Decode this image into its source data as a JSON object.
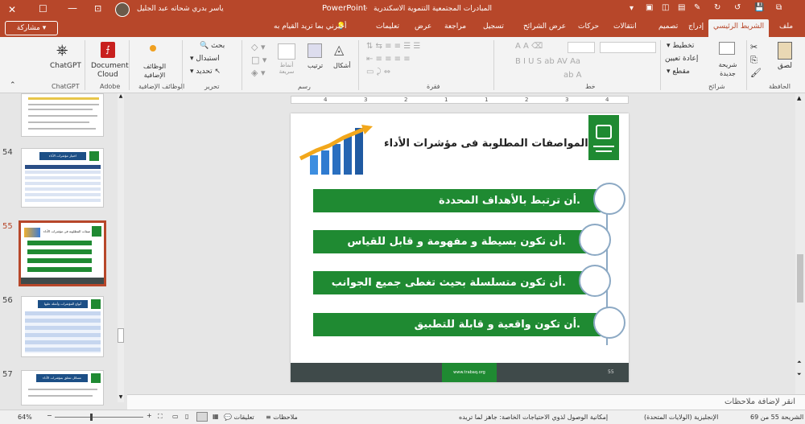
{
  "window": {
    "app_name": "PowerPoint",
    "file_title": "المبادرات المجتمعية التنموية الاسكندرية",
    "user_name": "ياسر بدري شحاته عبد الجليل",
    "accent_color": "#b7472a"
  },
  "tabs": {
    "file": "ملف",
    "home": "الشريط الرئيسي",
    "insert": "إدراج",
    "design": "تصميم",
    "transitions": "انتقالات",
    "animations": "حركات",
    "slideshow": "عرض الشرائح",
    "record": "تسجيل",
    "review": "مراجعة",
    "view": "عرض",
    "help": "تعليمات",
    "tell_me": "أخبرني بما تريد القيام به",
    "share": "مشاركة"
  },
  "ribbon": {
    "clipboard": {
      "label": "الحافظة",
      "paste": "لصق"
    },
    "slides": {
      "label": "شرائح",
      "new_slide": "شريحة جديدة",
      "layout": "تخطيط",
      "reset": "إعادة تعيين",
      "section": "مقطع"
    },
    "font": {
      "label": "خط"
    },
    "paragraph": {
      "label": "فقرة"
    },
    "drawing": {
      "label": "رسم",
      "shapes": "أشكال",
      "arrange": "ترتيب",
      "styles": "أنماط سريعة"
    },
    "editing": {
      "label": "تحرير",
      "find": "بحث",
      "replace": "استبدال",
      "select": "تحديد"
    },
    "addins": {
      "label": "الوظائف الإضافية",
      "addins_btn": "الوظائف الإضافية"
    },
    "adobe": {
      "label": "Adobe",
      "doc_cloud_1": "Document",
      "doc_cloud_2": "Cloud"
    },
    "chatgpt": {
      "label": "ChatGPT",
      "btn": "ChatGPT"
    }
  },
  "thumbnails": [
    {
      "number": "54",
      "title": "اختيار مؤشرات الأداء"
    },
    {
      "number": "55",
      "title": "المواصفات المطلوبة فى مؤشرات الأداء",
      "selected": true
    },
    {
      "number": "56",
      "title": "أنواع المؤشرات وأمثلة عليها"
    },
    {
      "number": "57",
      "title": "مسائل تتعلق بمؤشرات الأداء"
    }
  ],
  "slide": {
    "title": "المواصفات المطلوبة فى مؤشرات الأداء",
    "items": [
      "أن ترتبط بالأهداف المحددة.",
      "أن تكون بسيطة و مفهومة و قابل للقياس.",
      "أن تكون متسلسلة بحيث تغطى جميع الجوانب.",
      "أن تكون واقعية و قابلة للتطبيق."
    ],
    "footer_url": "www.trabaq.org",
    "page_number": "55",
    "green": "#1f8a32",
    "dark_footer": "#3f4a4a"
  },
  "notes": {
    "placeholder": "انقر لإضافة ملاحظات"
  },
  "statusbar": {
    "slide_info": "الشريحة 55 من 69",
    "language": "الإنجليزية (الولايات المتحدة)",
    "accessibility": "إمكانية الوصول لذوي الاحتياجات الخاصة: جاهز لما تريده",
    "notes_btn": "ملاحظات",
    "comments_btn": "تعليقات",
    "zoom": "64%"
  }
}
